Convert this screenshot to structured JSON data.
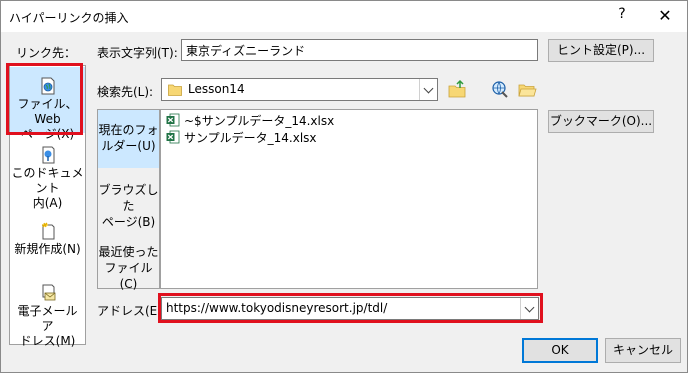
{
  "window": {
    "title": "ハイパーリンクの挿入",
    "help_label": "?",
    "close_label": "✕"
  },
  "link_to": {
    "label": "リンク先：",
    "items": [
      {
        "label_line1": "ファイル、Web",
        "label_line2": "ページ(X)",
        "icon": "web-page-icon"
      },
      {
        "label_line1": "このドキュメント",
        "label_line2": "内(A)",
        "icon": "document-place-icon"
      },
      {
        "label_line1": "新規作成(N)",
        "label_line2": "",
        "icon": "new-document-icon"
      },
      {
        "label_line1": "電子メール ア",
        "label_line2": "ドレス(M)",
        "icon": "email-icon"
      }
    ]
  },
  "display_text": {
    "label": "表示文字列(T):",
    "value": "東京ディズニーランド"
  },
  "screentip_button": "ヒント設定(P)...",
  "look_in": {
    "label": "検索先(L):",
    "value": "Lesson14"
  },
  "bookmark_button": "ブックマーク(O)...",
  "browse": {
    "items": [
      {
        "line1": "現在のフォ",
        "line2": "ルダー(U)"
      },
      {
        "line1": "ブラウズした",
        "line2": "ページ(B)"
      },
      {
        "line1": "最近使った",
        "line2": "ファイル(C)"
      }
    ]
  },
  "files": [
    {
      "name": "~$サンプルデータ_14.xlsx",
      "icon": "excel-file-icon"
    },
    {
      "name": "サンプルデータ_14.xlsx",
      "icon": "excel-file-icon"
    }
  ],
  "address": {
    "label": "アドレス(E):",
    "value": "https://www.tokyodisneyresort.jp/tdl/"
  },
  "ok_button": "OK",
  "cancel_button": "キャンセル",
  "colors": {
    "highlight": "#e0101e",
    "selected": "#cce8ff",
    "accent": "#0078d7"
  }
}
